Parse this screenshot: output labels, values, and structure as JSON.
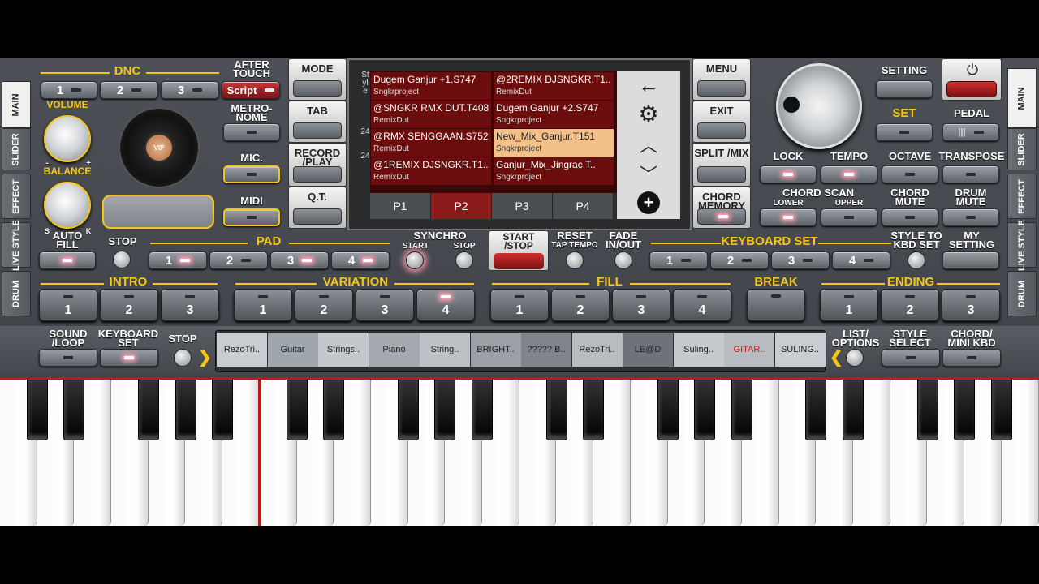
{
  "side_left": {
    "main": "MAIN",
    "slider": "SLIDER",
    "effect": "EFFECT",
    "live_style": "LIVE STYLE",
    "drum": "DRUM"
  },
  "side_right": {
    "main": "MAIN",
    "slider": "SLIDER",
    "effect": "EFFECT",
    "live_style": "LIVE STYLE",
    "drum": "DRUM"
  },
  "dnc": {
    "label": "DNC",
    "buttons": [
      "1",
      "2",
      "3"
    ],
    "script": "Script"
  },
  "after_touch": "AFTER TOUCH",
  "metronome": "METRO-NOME",
  "mic": "MIC.",
  "midi": "MIDI",
  "volume": "VOLUME",
  "balance": "BALANCE",
  "balance_s": "S",
  "balance_k": "K",
  "vol_minus": "-",
  "vol_plus": "+",
  "vip": "VIP",
  "menu_left": {
    "mode": "MODE",
    "tab": "TAB",
    "record": "RECORD /PLAY",
    "qt": "Q.T."
  },
  "menu_right": {
    "menu": "MENU",
    "exit": "EXIT",
    "split": "SPLIT /MIX",
    "chord_memory": "CHORD MEMORY"
  },
  "screen": {
    "side_label": "Style",
    "side_num": "24",
    "side_num2": "24",
    "col1": [
      {
        "title": "Dugem Ganjur +1.S747",
        "sub": "Sngkrproject"
      },
      {
        "title": "@SNGKR RMX DUT.T408",
        "sub": "RemixDut"
      },
      {
        "title": "@RMX SENGGAAN.S752",
        "sub": "RemixDut"
      },
      {
        "title": "@1REMIX DJSNGKR.T1..",
        "sub": "RemixDut"
      }
    ],
    "col2": [
      {
        "title": "@2REMIX DJSNGKR.T1..",
        "sub": "RemixDut"
      },
      {
        "title": "Dugem Ganjur +2.S747",
        "sub": "Sngkrproject"
      },
      {
        "title": "New_Mix_Ganjur.T151",
        "sub": "Sngkrproject"
      },
      {
        "title": "Ganjur_Mix_Jingrac.T..",
        "sub": "Sngkrproject"
      }
    ],
    "tabs": [
      "P1",
      "P2",
      "P3",
      "P4"
    ]
  },
  "right_top": {
    "setting": "SETTING",
    "set": "SET",
    "pedal": "PEDAL",
    "lock": "LOCK",
    "tempo": "TEMPO",
    "octave": "OCTAVE",
    "transpose": "TRANSPOSE",
    "chord_scan": "CHORD SCAN",
    "lower": "LOWER",
    "upper": "UPPER",
    "chord_mute": "CHORD MUTE",
    "drum_mute": "DRUM MUTE"
  },
  "row3": {
    "auto_fill": "AUTO FILL",
    "stop": "STOP",
    "pad": "PAD",
    "pad_buttons": [
      "1",
      "2",
      "3",
      "4"
    ],
    "synchro": "SYNCHRO",
    "sync_start": "START",
    "sync_stop": "STOP",
    "start_stop": "START /STOP",
    "reset": "RESET",
    "tap_tempo": "TAP TEMPO",
    "fade": "FADE IN/OUT",
    "keyboard_set": "KEYBOARD SET",
    "kbd_buttons": [
      "1",
      "2",
      "3",
      "4"
    ],
    "style_to_kbd": "STYLE TO KBD SET",
    "my_setting": "MY SETTING"
  },
  "row4": {
    "intro": "INTRO",
    "intro_b": [
      "1",
      "2",
      "3"
    ],
    "variation": "VARIATION",
    "var_b": [
      "1",
      "2",
      "3",
      "4"
    ],
    "fill": "FILL",
    "fill_b": [
      "1",
      "2",
      "3",
      "4"
    ],
    "break": "BREAK",
    "ending": "ENDING",
    "end_b": [
      "1",
      "2",
      "3"
    ]
  },
  "row5": {
    "sound_loop": "SOUND /LOOP",
    "keyboard_set": "KEYBOARD SET",
    "stop": "STOP",
    "list_options": "LIST/ OPTIONS",
    "style_select": "STYLE SELECT",
    "chord_mini": "CHORD/ MINI KBD",
    "instruments": [
      "RezoTri..",
      "Guitar",
      "Strings..",
      "Piano",
      "String..",
      "BRIGHT..",
      "????? B..",
      "RezoTri..",
      "LE@D",
      "Suling..",
      "GITAR..",
      "SULING.."
    ]
  },
  "colors": {
    "accent": "#f5c518",
    "led_on": "#ff9ab0",
    "screen_cell": "#6b0d0d",
    "selected": "#f2c088",
    "red": "#c41818"
  }
}
